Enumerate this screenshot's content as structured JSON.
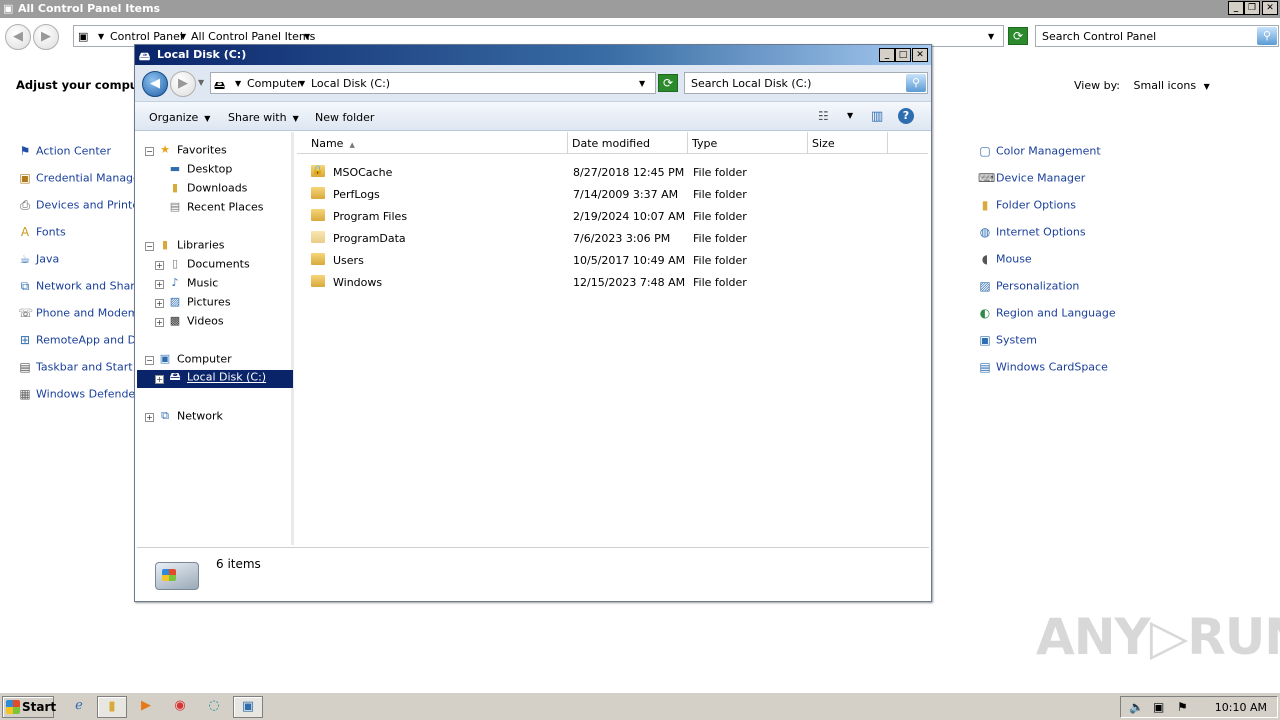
{
  "cp": {
    "title": "All Control Panel Items",
    "breadcrumb": [
      "Control Panel",
      "All Control Panel Items"
    ],
    "search_placeholder": "Search Control Panel",
    "heading": "Adjust your compute",
    "view_by_label": "View by:",
    "view_by_value": "Small icons",
    "left_items": [
      {
        "label": "Action Center",
        "icon": "flag-icon"
      },
      {
        "label": "Credential Manager",
        "icon": "vault-icon"
      },
      {
        "label": "Devices and Printers",
        "icon": "printer-icon"
      },
      {
        "label": "Fonts",
        "icon": "fonts-icon"
      },
      {
        "label": "Java",
        "icon": "java-icon"
      },
      {
        "label": "Network and Sharing",
        "icon": "network-icon"
      },
      {
        "label": "Phone and Modem",
        "icon": "phone-icon"
      },
      {
        "label": "RemoteApp and Des",
        "icon": "remoteapp-icon"
      },
      {
        "label": "Taskbar and Start M",
        "icon": "taskbar-icon"
      },
      {
        "label": "Windows Defender",
        "icon": "defender-icon"
      }
    ],
    "right_items": [
      {
        "label": "Color Management",
        "icon": "monitor-icon"
      },
      {
        "label": "Device Manager",
        "icon": "device-manager-icon"
      },
      {
        "label": "Folder Options",
        "icon": "folder-icon"
      },
      {
        "label": "Internet Options",
        "icon": "globe-icon"
      },
      {
        "label": "Mouse",
        "icon": "mouse-icon"
      },
      {
        "label": "Personalization",
        "icon": "personalization-icon"
      },
      {
        "label": "Region and Language",
        "icon": "region-icon"
      },
      {
        "label": "System",
        "icon": "system-icon"
      },
      {
        "label": "Windows CardSpace",
        "icon": "cardspace-icon"
      }
    ]
  },
  "explorer": {
    "title": "Local Disk (C:)",
    "breadcrumb": [
      "Computer",
      "Local Disk (C:)"
    ],
    "search_placeholder": "Search Local Disk (C:)",
    "toolbar": {
      "organize": "Organize",
      "share": "Share with",
      "new_folder": "New folder"
    },
    "tree": {
      "favorites": "Favorites",
      "desktop": "Desktop",
      "downloads": "Downloads",
      "recent": "Recent Places",
      "libraries": "Libraries",
      "documents": "Documents",
      "music": "Music",
      "pictures": "Pictures",
      "videos": "Videos",
      "computer": "Computer",
      "local_disk": "Local Disk (C:)",
      "network": "Network"
    },
    "columns": {
      "name": "Name",
      "date": "Date modified",
      "type": "Type",
      "size": "Size"
    },
    "files": [
      {
        "name": "MSOCache",
        "date": "8/27/2018 12:45 PM",
        "type": "File folder",
        "locked": true
      },
      {
        "name": "PerfLogs",
        "date": "7/14/2009 3:37 AM",
        "type": "File folder"
      },
      {
        "name": "Program Files",
        "date": "2/19/2024 10:07 AM",
        "type": "File folder"
      },
      {
        "name": "ProgramData",
        "date": "7/6/2023 3:06 PM",
        "type": "File folder"
      },
      {
        "name": "Users",
        "date": "10/5/2017 10:49 AM",
        "type": "File folder"
      },
      {
        "name": "Windows",
        "date": "12/15/2023 7:48 AM",
        "type": "File folder"
      }
    ],
    "status": "6 items"
  },
  "taskbar": {
    "start": "Start",
    "clock": "10:10 AM"
  },
  "watermark": "ANY RUN"
}
